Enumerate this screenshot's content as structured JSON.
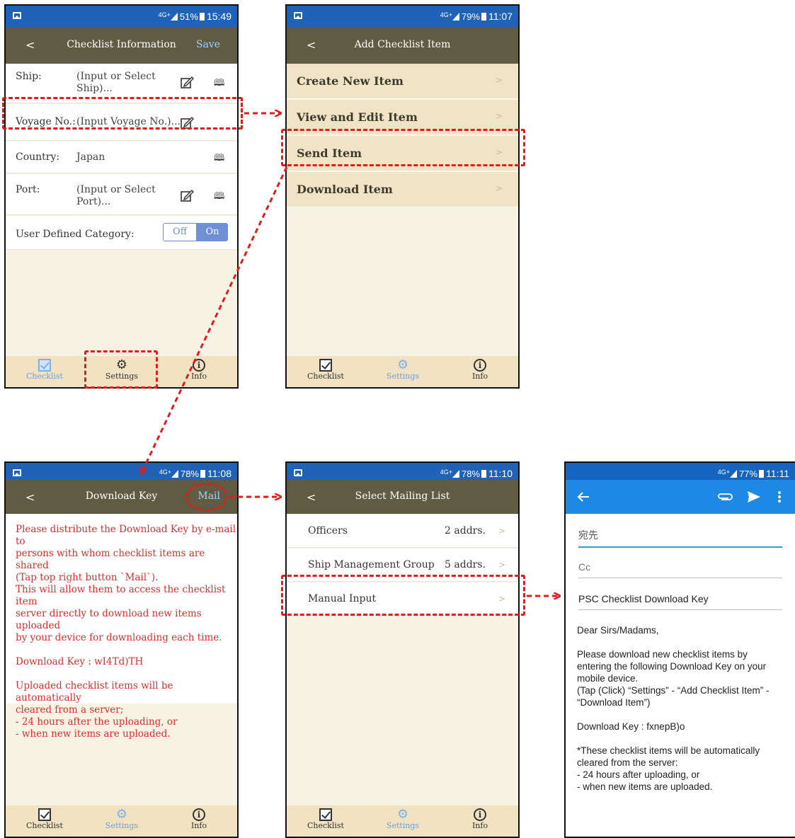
{
  "colors": {
    "annotation": "#e21b1b",
    "navbar": "#5f5c43",
    "statusbar": "#1f62b8",
    "tabbar": "#f1e2c2",
    "error_text": "#e82a2a",
    "gmail_bar": "#1e88e5"
  },
  "screen1": {
    "status": {
      "network": "4G+",
      "battery": "51%",
      "time": "15:49"
    },
    "nav": {
      "back": "<",
      "title": "Checklist Information",
      "action": "Save"
    },
    "rows": {
      "ship_label": "Ship:",
      "ship_value": "(Input or Select Ship)...",
      "voyage_label": "Voyage No.:",
      "voyage_value": "(Input Voyage No.)...",
      "country_label": "Country:",
      "country_value": "Japan",
      "port_label": "Port:",
      "port_value": "(Input or Select Port)...",
      "category_label": "User Defined Category:",
      "toggle_off": "Off",
      "toggle_on": "On"
    },
    "tabs": {
      "checklist": "Checklist",
      "settings": "Settings",
      "info": "Info"
    }
  },
  "screen2": {
    "status": {
      "network": "4G+",
      "battery": "79%",
      "time": "11:07"
    },
    "nav": {
      "back": "<",
      "title": "Add Checklist Item"
    },
    "menu": [
      "Create New Item",
      "View and Edit Item",
      "Send Item",
      "Download Item"
    ],
    "chevron": ">",
    "tabs": {
      "checklist": "Checklist",
      "settings": "Settings",
      "info": "Info"
    }
  },
  "screen3": {
    "status": {
      "network": "4G+",
      "battery": "78%",
      "time": "11:08"
    },
    "nav": {
      "back": "<",
      "title": "Download Key",
      "action": "Mail"
    },
    "lines1": [
      "Please distribute the Download Key by e-mail to",
      "persons with whom checklist items are shared",
      "(Tap top right button `Mail`).",
      "This will allow them to access the checklist item",
      "server directly to download new items uploaded",
      "by your device for downloading each time."
    ],
    "key_line": "Download Key : wI4Td)TH",
    "lines2": [
      "Uploaded checklist items will be automatically",
      "cleared from a server;",
      "- 24 hours after the uploading, or",
      "- when new items are uploaded."
    ],
    "tabs": {
      "checklist": "Checklist",
      "settings": "Settings",
      "info": "Info"
    }
  },
  "screen4": {
    "status": {
      "network": "4G+",
      "battery": "78%",
      "time": "11:10"
    },
    "nav": {
      "back": "<",
      "title": "Select Mailing List"
    },
    "items": [
      {
        "label": "Officers",
        "count": "2 addrs."
      },
      {
        "label": "Ship Management Group",
        "count": "5 addrs."
      },
      {
        "label": "Manual Input",
        "count": ""
      }
    ],
    "chevron": ">",
    "tabs": {
      "checklist": "Checklist",
      "settings": "Settings",
      "info": "Info"
    }
  },
  "screen5": {
    "status": {
      "network": "4G+",
      "battery": "77%",
      "time": "11:11"
    },
    "to_placeholder": "宛先",
    "cc_placeholder": "Cc",
    "subject": "PSC Checklist Download Key",
    "body": [
      "Dear Sirs/Madams,",
      "",
      "Please download new checklist items by",
      "entering the following Download Key on your",
      "mobile device.",
      "(Tap (Click) “Settings” - “Add Checklist Item” -",
      "“Download Item”)",
      "",
      "Download Key : fxnepB)o",
      "",
      "*These checklist items will be automatically",
      "cleared from the server:",
      "- 24 hours after uploading, or",
      "- when new items are uploaded."
    ]
  }
}
